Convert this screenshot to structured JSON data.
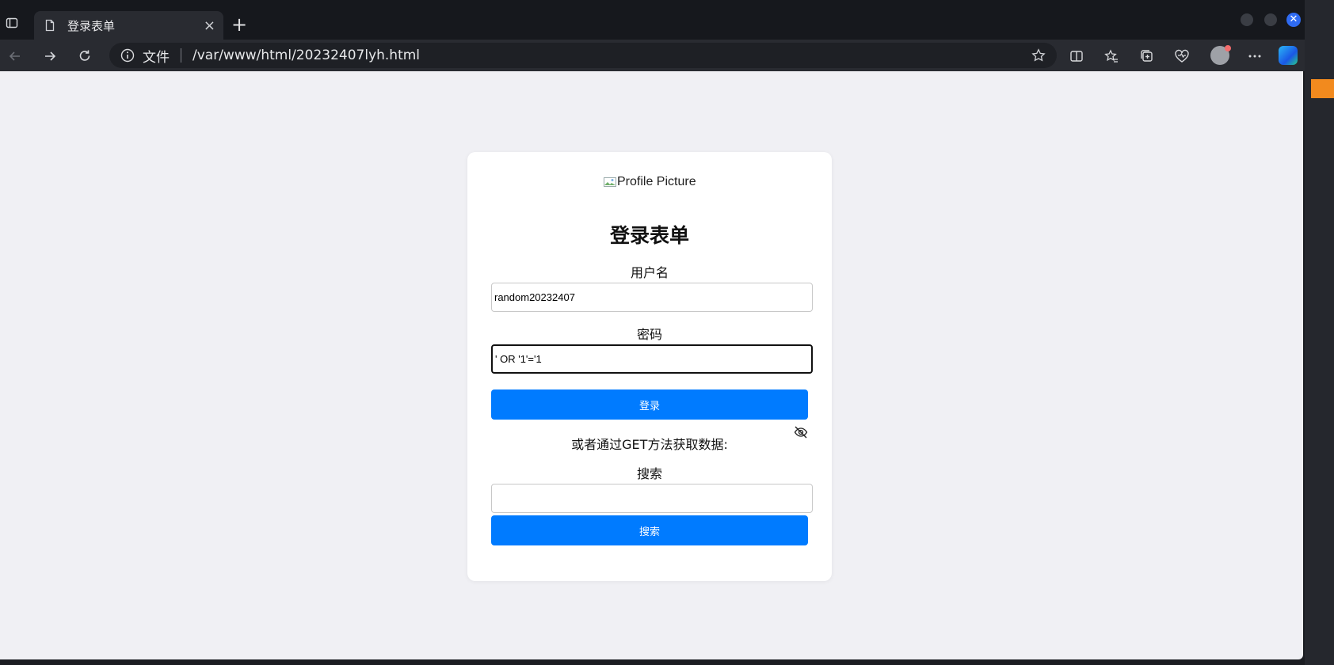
{
  "browser": {
    "tab": {
      "title": "登录表单"
    },
    "address": {
      "scheme_label": "文件",
      "url": "/var/www/html/20232407lyh.html"
    }
  },
  "page": {
    "profile_alt": "Profile Picture",
    "form_title": "登录表单",
    "username": {
      "label": "用户名",
      "value": "random20232407"
    },
    "password": {
      "label": "密码",
      "value": "' OR '1'='1"
    },
    "login_button": "登录",
    "get_note": "或者通过GET方法获取数据:",
    "search": {
      "label": "搜索",
      "value": "",
      "button": "搜索"
    }
  },
  "colors": {
    "primary_button": "#007bff",
    "page_background": "#f0f0f4",
    "card_background": "#ffffff"
  }
}
